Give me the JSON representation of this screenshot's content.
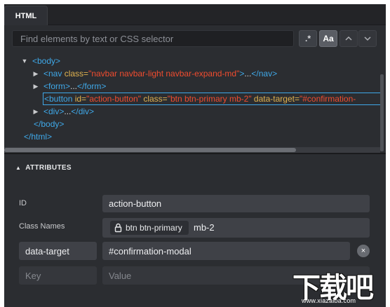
{
  "tabs": [
    {
      "label": "HTML",
      "active": true
    }
  ],
  "search": {
    "placeholder": "Find elements by text or CSS selector",
    "regex_label": ".*",
    "case_label": "Aa",
    "up_icon": "chevron-up-icon",
    "down_icon": "chevron-down-icon"
  },
  "tree": {
    "body_open": "<body>",
    "nav": {
      "open": "<nav",
      "attr": "class=",
      "value": "\"navbar navbar-light navbar-expand-md\"",
      "rest": ">",
      "ellipsis": "...",
      "close": "</nav>"
    },
    "form": {
      "open": "<form>",
      "ellipsis": "...",
      "close": "</form>"
    },
    "button": {
      "open": "<button",
      "id_attr": "id=",
      "id_value": "\"action-button\"",
      "class_attr": "class=",
      "class_value": "\"btn btn-primary mb-2\"",
      "target_attr": "data-target=",
      "target_value": "\"#confirmation-"
    },
    "div": {
      "open": "<div>",
      "ellipsis": "...",
      "close": "</div>"
    },
    "body_close": "</body>",
    "html_close": "</html>"
  },
  "attributes": {
    "heading": "ATTRIBUTES",
    "id_label": "ID",
    "id_value": "action-button",
    "class_label": "Class Names",
    "class_locked": "btn btn-primary",
    "class_extra": "mb-2",
    "custom_key": "data-target",
    "custom_value": "#confirmation-modal",
    "remove_icon": "×",
    "new_key_placeholder": "Key",
    "new_value_placeholder": "Value"
  },
  "watermark": {
    "text": "下载吧",
    "url": "www.xiazaiba.com"
  },
  "colors": {
    "tag": "#3fa8e8",
    "attr": "#e0b24f",
    "value": "#f04c2f",
    "panel": "#2b2d31"
  }
}
